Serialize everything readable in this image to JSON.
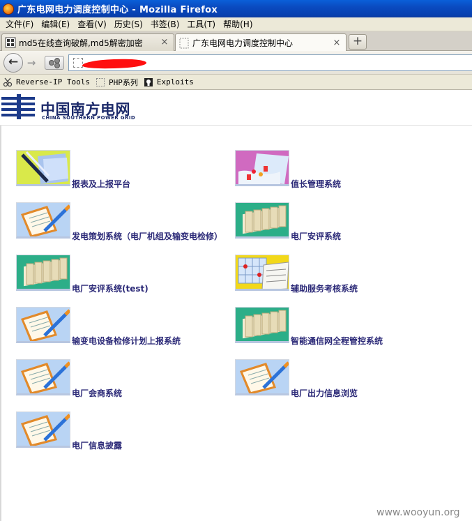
{
  "window": {
    "title": "广东电网电力调度控制中心 - Mozilla Firefox"
  },
  "menu": [
    "文件(F)",
    "编辑(E)",
    "查看(V)",
    "历史(S)",
    "书签(B)",
    "工具(T)",
    "帮助(H)"
  ],
  "tabs": [
    {
      "label": "md5在线查询破解,md5解密加密",
      "close": "×"
    },
    {
      "label": "广东电网电力调度控制中心",
      "close": "×"
    }
  ],
  "newtab": "+",
  "nav": {
    "back": "←",
    "forward": "→",
    "url": ""
  },
  "bookmarks": [
    "Reverse-IP Tools",
    "PHP系列",
    "Exploits"
  ],
  "logo": {
    "cn": "中国南方电网",
    "en": "CHINA SOUTHERN POWER GRID"
  },
  "systems": [
    {
      "label": "报表及上报平台",
      "thumb": "pen-docs"
    },
    {
      "label": "值长管理系统",
      "thumb": "pink-chart"
    },
    {
      "label": "发电策划系统（电厂机组及输变电检修）",
      "thumb": "clipboard-pencil"
    },
    {
      "label": "电厂安评系统",
      "thumb": "green-binders"
    },
    {
      "label": "电厂安评系统(test)",
      "thumb": "green-binders"
    },
    {
      "label": "辅助服务考核系统",
      "thumb": "yellow-grid"
    },
    {
      "label": "输变电设备检修计划上报系统",
      "thumb": "clipboard-pencil"
    },
    {
      "label": "智能通信网全程管控系统",
      "thumb": "green-binders"
    },
    {
      "label": "电厂会商系统",
      "thumb": "clipboard-pencil"
    },
    {
      "label": "电厂出力信息浏览",
      "thumb": "clipboard-pencil"
    },
    {
      "label": "电厂信息披露",
      "thumb": "clipboard-pencil"
    }
  ],
  "watermark": "www.wooyun.org",
  "colors": {
    "titlebar": "#0a4bc0",
    "chrome": "#ece9d8",
    "link": "#2c2a78",
    "logo": "#1c2a6a",
    "redaction": "#ff0f0f"
  }
}
